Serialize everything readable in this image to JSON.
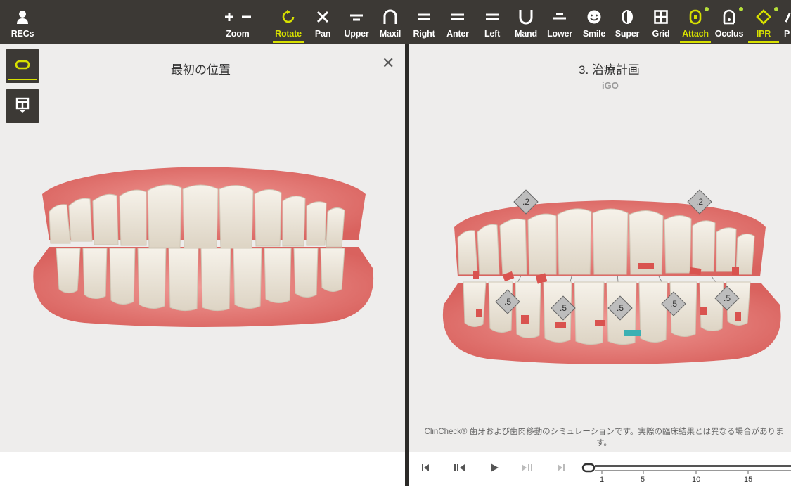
{
  "toolbar": {
    "items": [
      {
        "label": "RECs",
        "icon": "person-icon"
      },
      {
        "label": "Zoom",
        "icon": "zoom-plus-minus-icon"
      },
      {
        "label": "Rotate",
        "icon": "rotate-icon",
        "active": true
      },
      {
        "label": "Pan",
        "icon": "pan-arrows-icon"
      },
      {
        "label": "Upper",
        "icon": "upper-view-icon"
      },
      {
        "label": "Maxil",
        "icon": "maxillary-arch-icon"
      },
      {
        "label": "Right",
        "icon": "right-view-icon"
      },
      {
        "label": "Anter",
        "icon": "anterior-view-icon"
      },
      {
        "label": "Left",
        "icon": "left-view-icon"
      },
      {
        "label": "Mand",
        "icon": "mandibular-arch-icon"
      },
      {
        "label": "Lower",
        "icon": "lower-view-icon"
      },
      {
        "label": "Smile",
        "icon": "smile-face-icon"
      },
      {
        "label": "Super",
        "icon": "superimpose-icon"
      },
      {
        "label": "Grid",
        "icon": "grid-icon"
      },
      {
        "label": "Attach",
        "icon": "attachment-icon",
        "active": true,
        "indicator": true
      },
      {
        "label": "Occlus",
        "icon": "occlusion-tooth-icon",
        "indicator": true
      },
      {
        "label": "IPR",
        "icon": "ipr-diamond-icon",
        "active": true,
        "indicator": true
      },
      {
        "label": "P",
        "icon": "more-icon"
      }
    ],
    "accent": "#d7e000",
    "indicator_color": "#b6e03a",
    "background": "#3c3935"
  },
  "left_panel": {
    "title": "最初の位置",
    "close_symbol": "✕"
  },
  "right_panel": {
    "title": "3. 治療計画",
    "subtitle": "iGO",
    "ipr_upper": [
      ".2",
      ".2"
    ],
    "ipr_lower": [
      ".5",
      ".5",
      ".5",
      ".5",
      ".5"
    ],
    "disclaimer": "ClinCheck® 歯牙および歯肉移動のシミュレーションです。実際の臨床結果とは異なる場合があります。"
  },
  "playback": {
    "buttons": [
      "first-stage",
      "previous-stage",
      "play",
      "next-stage",
      "last-stage"
    ],
    "ticks": [
      "1",
      "5",
      "10",
      "15"
    ],
    "current_stage_fraction": 0.0
  },
  "colors": {
    "gum": "#ec8683",
    "tooth": "#efe9dd",
    "attachment": "#d9534f",
    "ipr_marker": "#3bb0b3",
    "panel_bg": "#eeedec"
  }
}
